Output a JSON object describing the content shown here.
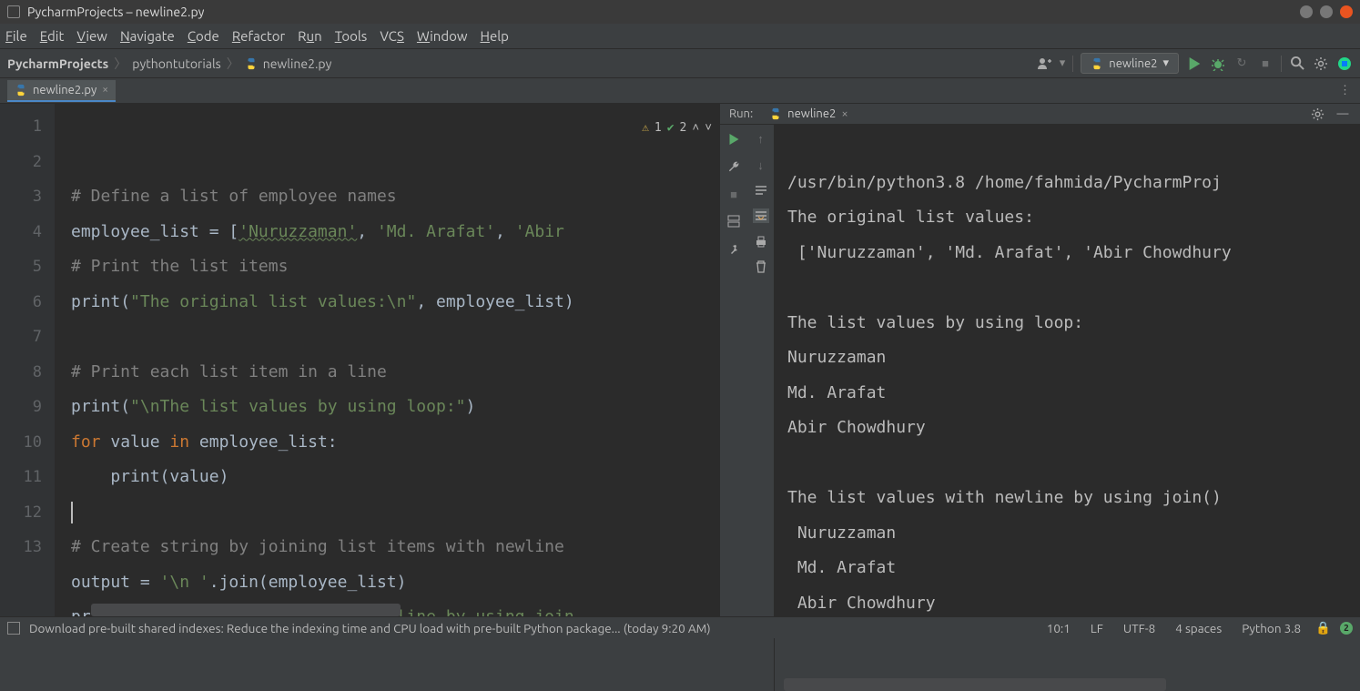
{
  "window": {
    "title": "PycharmProjects – newline2.py"
  },
  "menu": {
    "file": "File",
    "edit": "Edit",
    "view": "View",
    "navigate": "Navigate",
    "code": "Code",
    "refactor": "Refactor",
    "run": "Run",
    "tools": "Tools",
    "vcs": "VCS",
    "window": "Window",
    "help": "Help"
  },
  "breadcrumb": {
    "root": "PycharmProjects",
    "folder": "pythontutorials",
    "file": "newline2.py"
  },
  "run_config": {
    "name": "newline2"
  },
  "editor_tab": {
    "filename": "newline2.py"
  },
  "editor": {
    "line_numbers": [
      "1",
      "2",
      "3",
      "4",
      "5",
      "6",
      "7",
      "8",
      "9",
      "10",
      "11",
      "12",
      "13"
    ],
    "inspections": {
      "warn_count": "1",
      "typo_count": "2"
    },
    "code": {
      "l1": "# Define a list of employee names",
      "l2a": "employee_list = [",
      "l2_s1": "'Nuruzzaman'",
      "l2_c1": ", ",
      "l2_s2": "'Md. Arafat'",
      "l2_c2": ", ",
      "l2_s3": "'Abir",
      "l3": "# Print the list items",
      "l4a": "print",
      "l4p": "(",
      "l4s": "\"The original list values:\\n\"",
      "l4c": ", employee_list)",
      "l6": "# Print each list item in a line",
      "l7a": "print",
      "l7p": "(",
      "l7s": "\"\\nThe list values by using loop:\"",
      "l7e": ")",
      "l8a": "for",
      "l8b": " value ",
      "l8c": "in",
      "l8d": " employee_list:",
      "l9a": "    print",
      "l9b": "(value)",
      "l11": "# Create string by joining list items with newline",
      "l12a": "output = ",
      "l12b": "'\\n '",
      "l12c": ".join(employee_list)",
      "l13a": "print",
      "l13p": "(",
      "l13s": "\"\\nThe list values with newline by using join",
      "l13e": ""
    }
  },
  "run_panel": {
    "label": "Run:",
    "tab_name": "newline2",
    "output": {
      "o1": "/usr/bin/python3.8 /home/fahmida/PycharmProj",
      "o2": "The original list values:",
      "o3": " ['Nuruzzaman', 'Md. Arafat', 'Abir Chowdhury",
      "o4": "",
      "o5": "The list values by using loop:",
      "o6": "Nuruzzaman",
      "o7": "Md. Arafat",
      "o8": "Abir Chowdhury",
      "o9": "",
      "o10": "The list values with newline by using join()",
      "o11": " Nuruzzaman",
      "o12": " Md. Arafat",
      "o13": " Abir Chowdhury"
    }
  },
  "statusbar": {
    "msg": "Download pre-built shared indexes: Reduce the indexing time and CPU load with pre-built Python package... (today 9:20 AM)",
    "pos": "10:1",
    "eol": "LF",
    "encoding": "UTF-8",
    "indent": "4 spaces",
    "interpreter": "Python 3.8",
    "badge": "2"
  }
}
